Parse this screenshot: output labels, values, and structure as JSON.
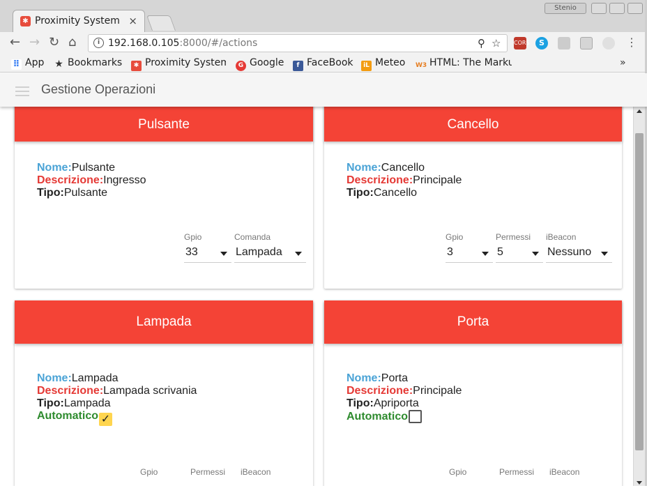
{
  "browser": {
    "tab_title": "Proximity System",
    "tab_close": "×",
    "window_user": "Stenio",
    "url_host": "192.168.0.105",
    "url_rest": ":8000/#/actions",
    "bookmarks": [
      {
        "label": "App",
        "icon": "apps-grid-icon"
      },
      {
        "label": "Bookmarks",
        "icon": "star-icon"
      },
      {
        "label": "Proximity System",
        "icon": "proximity-favicon"
      },
      {
        "label": "Google",
        "icon": "google-favicon"
      },
      {
        "label": "FaceBook",
        "icon": "facebook-favicon"
      },
      {
        "label": "Meteo",
        "icon": "meteo-favicon"
      },
      {
        "label": "HTML: The Marku",
        "icon": "w3schools-favicon"
      }
    ],
    "bookmarks_more": "»",
    "extensions": [
      "cors-extension-icon",
      "skype-extension-icon",
      "camera-extension-icon",
      "shield-extension-icon",
      "target-extension-icon"
    ]
  },
  "app": {
    "title": "Gestione Operazioni"
  },
  "labels": {
    "nome": "Nome:",
    "descrizione": "Descrizione:",
    "tipo": "Tipo:",
    "automatico": "Automatico"
  },
  "cards": [
    {
      "header": "Pulsante",
      "nome": "Pulsante",
      "descrizione": "Ingresso",
      "tipo": "Pulsante",
      "fields": [
        {
          "label": "Gpio",
          "value": "33"
        },
        {
          "label": "Comanda",
          "value": "Lampada"
        }
      ]
    },
    {
      "header": "Cancello",
      "nome": "Cancello",
      "descrizione": "Principale",
      "tipo": "Cancello",
      "fields": [
        {
          "label": "Gpio",
          "value": "3"
        },
        {
          "label": "Permessi",
          "value": "5"
        },
        {
          "label": "iBeacon",
          "value": "Nessuno"
        }
      ]
    },
    {
      "header": "Lampada",
      "nome": "Lampada",
      "descrizione": "Lampada scrivania",
      "tipo": "Lampada",
      "automatico": true,
      "fields": [
        {
          "label": "Gpio",
          "value": ""
        },
        {
          "label": "Permessi",
          "value": ""
        },
        {
          "label": "iBeacon",
          "value": ""
        }
      ]
    },
    {
      "header": "Porta",
      "nome": "Porta",
      "descrizione": "Principale",
      "tipo": "Apriporta",
      "automatico": false,
      "fields": [
        {
          "label": "Gpio",
          "value": ""
        },
        {
          "label": "Permessi",
          "value": ""
        },
        {
          "label": "iBeacon",
          "value": ""
        }
      ]
    }
  ],
  "colors": {
    "header_red": "#f44336",
    "nome_blue": "#4aa3d6",
    "descrizione_red": "#e53935",
    "automatico_green": "#2e8b2e",
    "checkbox_checked": "#ffd54f"
  }
}
